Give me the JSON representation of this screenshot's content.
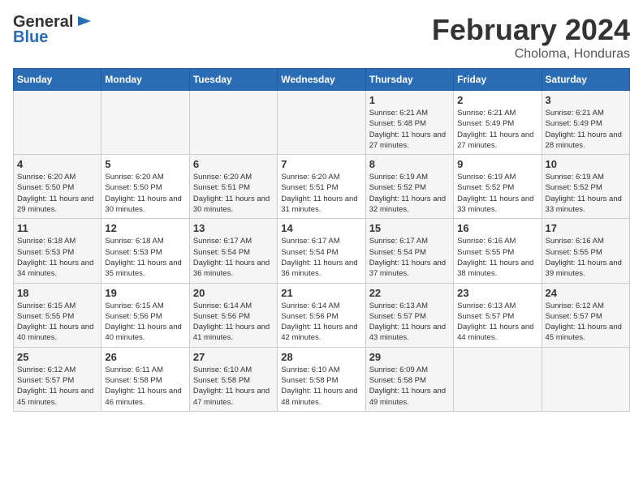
{
  "logo": {
    "general": "General",
    "blue": "Blue"
  },
  "title": "February 2024",
  "subtitle": "Choloma, Honduras",
  "days_of_week": [
    "Sunday",
    "Monday",
    "Tuesday",
    "Wednesday",
    "Thursday",
    "Friday",
    "Saturday"
  ],
  "weeks": [
    [
      {
        "day": "",
        "info": ""
      },
      {
        "day": "",
        "info": ""
      },
      {
        "day": "",
        "info": ""
      },
      {
        "day": "",
        "info": ""
      },
      {
        "day": "1",
        "info": "Sunrise: 6:21 AM\nSunset: 5:48 PM\nDaylight: 11 hours\nand 27 minutes."
      },
      {
        "day": "2",
        "info": "Sunrise: 6:21 AM\nSunset: 5:49 PM\nDaylight: 11 hours\nand 27 minutes."
      },
      {
        "day": "3",
        "info": "Sunrise: 6:21 AM\nSunset: 5:49 PM\nDaylight: 11 hours\nand 28 minutes."
      }
    ],
    [
      {
        "day": "4",
        "info": "Sunrise: 6:20 AM\nSunset: 5:50 PM\nDaylight: 11 hours\nand 29 minutes."
      },
      {
        "day": "5",
        "info": "Sunrise: 6:20 AM\nSunset: 5:50 PM\nDaylight: 11 hours\nand 30 minutes."
      },
      {
        "day": "6",
        "info": "Sunrise: 6:20 AM\nSunset: 5:51 PM\nDaylight: 11 hours\nand 30 minutes."
      },
      {
        "day": "7",
        "info": "Sunrise: 6:20 AM\nSunset: 5:51 PM\nDaylight: 11 hours\nand 31 minutes."
      },
      {
        "day": "8",
        "info": "Sunrise: 6:19 AM\nSunset: 5:52 PM\nDaylight: 11 hours\nand 32 minutes."
      },
      {
        "day": "9",
        "info": "Sunrise: 6:19 AM\nSunset: 5:52 PM\nDaylight: 11 hours\nand 33 minutes."
      },
      {
        "day": "10",
        "info": "Sunrise: 6:19 AM\nSunset: 5:52 PM\nDaylight: 11 hours\nand 33 minutes."
      }
    ],
    [
      {
        "day": "11",
        "info": "Sunrise: 6:18 AM\nSunset: 5:53 PM\nDaylight: 11 hours\nand 34 minutes."
      },
      {
        "day": "12",
        "info": "Sunrise: 6:18 AM\nSunset: 5:53 PM\nDaylight: 11 hours\nand 35 minutes."
      },
      {
        "day": "13",
        "info": "Sunrise: 6:17 AM\nSunset: 5:54 PM\nDaylight: 11 hours\nand 36 minutes."
      },
      {
        "day": "14",
        "info": "Sunrise: 6:17 AM\nSunset: 5:54 PM\nDaylight: 11 hours\nand 36 minutes."
      },
      {
        "day": "15",
        "info": "Sunrise: 6:17 AM\nSunset: 5:54 PM\nDaylight: 11 hours\nand 37 minutes."
      },
      {
        "day": "16",
        "info": "Sunrise: 6:16 AM\nSunset: 5:55 PM\nDaylight: 11 hours\nand 38 minutes."
      },
      {
        "day": "17",
        "info": "Sunrise: 6:16 AM\nSunset: 5:55 PM\nDaylight: 11 hours\nand 39 minutes."
      }
    ],
    [
      {
        "day": "18",
        "info": "Sunrise: 6:15 AM\nSunset: 5:55 PM\nDaylight: 11 hours\nand 40 minutes."
      },
      {
        "day": "19",
        "info": "Sunrise: 6:15 AM\nSunset: 5:56 PM\nDaylight: 11 hours\nand 40 minutes."
      },
      {
        "day": "20",
        "info": "Sunrise: 6:14 AM\nSunset: 5:56 PM\nDaylight: 11 hours\nand 41 minutes."
      },
      {
        "day": "21",
        "info": "Sunrise: 6:14 AM\nSunset: 5:56 PM\nDaylight: 11 hours\nand 42 minutes."
      },
      {
        "day": "22",
        "info": "Sunrise: 6:13 AM\nSunset: 5:57 PM\nDaylight: 11 hours\nand 43 minutes."
      },
      {
        "day": "23",
        "info": "Sunrise: 6:13 AM\nSunset: 5:57 PM\nDaylight: 11 hours\nand 44 minutes."
      },
      {
        "day": "24",
        "info": "Sunrise: 6:12 AM\nSunset: 5:57 PM\nDaylight: 11 hours\nand 45 minutes."
      }
    ],
    [
      {
        "day": "25",
        "info": "Sunrise: 6:12 AM\nSunset: 5:57 PM\nDaylight: 11 hours\nand 45 minutes."
      },
      {
        "day": "26",
        "info": "Sunrise: 6:11 AM\nSunset: 5:58 PM\nDaylight: 11 hours\nand 46 minutes."
      },
      {
        "day": "27",
        "info": "Sunrise: 6:10 AM\nSunset: 5:58 PM\nDaylight: 11 hours\nand 47 minutes."
      },
      {
        "day": "28",
        "info": "Sunrise: 6:10 AM\nSunset: 5:58 PM\nDaylight: 11 hours\nand 48 minutes."
      },
      {
        "day": "29",
        "info": "Sunrise: 6:09 AM\nSunset: 5:58 PM\nDaylight: 11 hours\nand 49 minutes."
      },
      {
        "day": "",
        "info": ""
      },
      {
        "day": "",
        "info": ""
      }
    ]
  ]
}
